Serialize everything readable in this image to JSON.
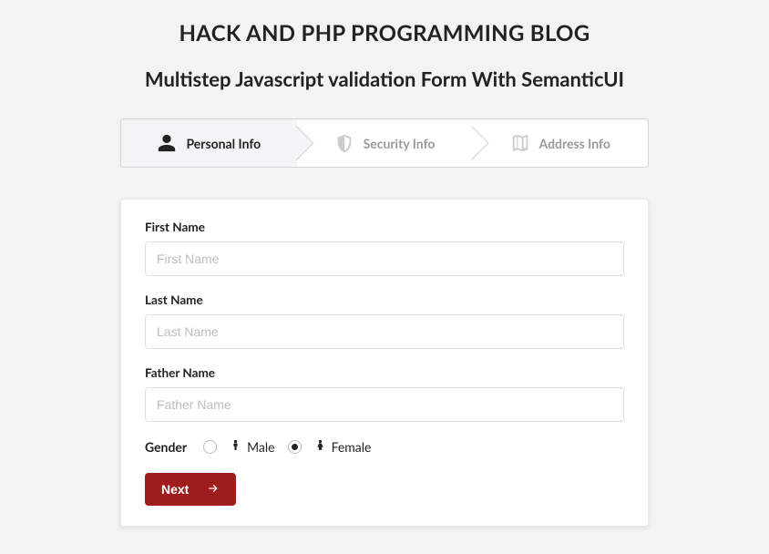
{
  "header": {
    "title": "HACK AND PHP PROGRAMMING BLOG",
    "subtitle": "Multistep Javascript validation Form With SemanticUI"
  },
  "steps": [
    {
      "label": "Personal Info",
      "icon": "user",
      "active": true
    },
    {
      "label": "Security Info",
      "icon": "shield",
      "active": false
    },
    {
      "label": "Address Info",
      "icon": "map",
      "active": false
    }
  ],
  "form": {
    "first_name": {
      "label": "First Name",
      "placeholder": "First Name",
      "value": ""
    },
    "last_name": {
      "label": "Last Name",
      "placeholder": "Last Name",
      "value": ""
    },
    "father_name": {
      "label": "Father Name",
      "placeholder": "Father Name",
      "value": ""
    },
    "gender": {
      "label": "Gender",
      "options": [
        {
          "key": "male",
          "label": "Male"
        },
        {
          "key": "female",
          "label": "Female"
        }
      ],
      "selected": "female"
    },
    "next_label": "Next"
  }
}
